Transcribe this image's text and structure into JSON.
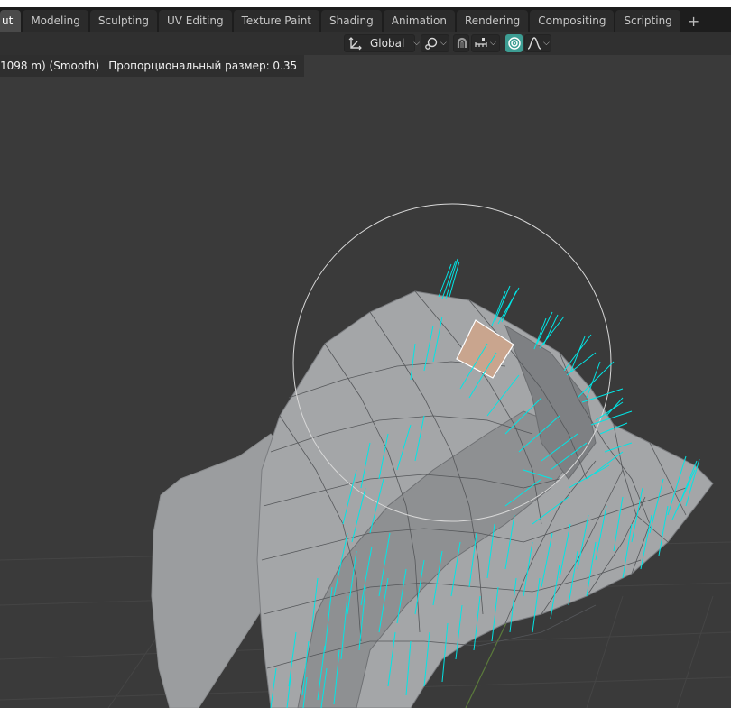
{
  "tabs": [
    {
      "label": "ut",
      "active": true
    },
    {
      "label": "Modeling"
    },
    {
      "label": "Sculpting"
    },
    {
      "label": "UV Editing"
    },
    {
      "label": "Texture Paint"
    },
    {
      "label": "Shading"
    },
    {
      "label": "Animation"
    },
    {
      "label": "Rendering"
    },
    {
      "label": "Compositing"
    },
    {
      "label": "Scripting"
    }
  ],
  "add_tab_symbol": "+",
  "header": {
    "orientation": {
      "icon": "transform-orientation-icon",
      "value": "Global"
    },
    "pivot_icon": "pivot-point-icon",
    "snap_icon": "snap-magnet-icon",
    "snap_target_icon": "snap-increment-icon",
    "proportional_icon": "proportional-editing-icon",
    "falloff_icon": "falloff-curve-icon"
  },
  "status": {
    "measure": "1098 m) (Smooth)",
    "proportional": "Пропорциональный размер: 0.35"
  },
  "colors": {
    "background": "#3a3a3a",
    "mesh": "#a4a6a8",
    "normals": "#00e6e6",
    "selected_face": "#c9a58e",
    "active_toggle": "#3d9d93"
  }
}
